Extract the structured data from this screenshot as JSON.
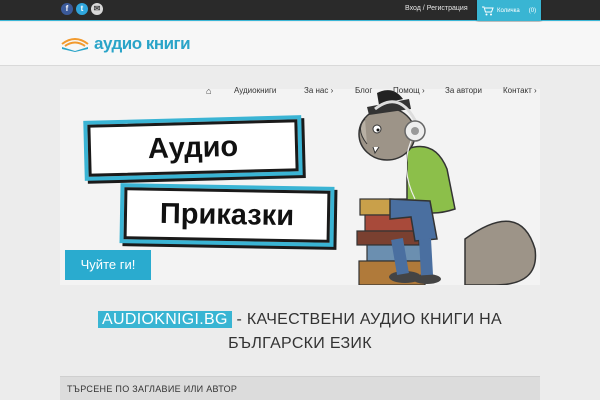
{
  "topbar": {
    "social": [
      {
        "icon": "facebook-icon",
        "glyph": "f"
      },
      {
        "icon": "twitter-icon",
        "glyph": "t"
      },
      {
        "icon": "mail-icon",
        "glyph": "✉"
      }
    ],
    "login_label": "Вход",
    "separator": "/",
    "register_label": "Регистрация",
    "cart_label": "Количка",
    "cart_count": "(0)"
  },
  "header": {
    "logo_text": "аудио книги"
  },
  "nav": {
    "home_icon": "home-icon",
    "items": [
      "Аудиокниги",
      "За нас ›",
      "Блог",
      "Помощ ›",
      "За автори",
      "Контакт ›"
    ]
  },
  "banner": {
    "line1": "Аудио",
    "line2": "Приказки",
    "cta": "Чуйте ги!"
  },
  "tagline": {
    "badge": "AUDIOKNIGI.BG",
    "text": " - КАЧЕСТВЕНИ АУДИО КНИГИ НА",
    "line2": "БЪЛГАРСКИ ЕЗИК"
  },
  "search": {
    "title": "ТЪРСЕНЕ ПО ЗАГЛАВИЕ ИЛИ АВТОР"
  },
  "colors": {
    "accent": "#39b5d3",
    "topbar": "#2a2a2a"
  }
}
